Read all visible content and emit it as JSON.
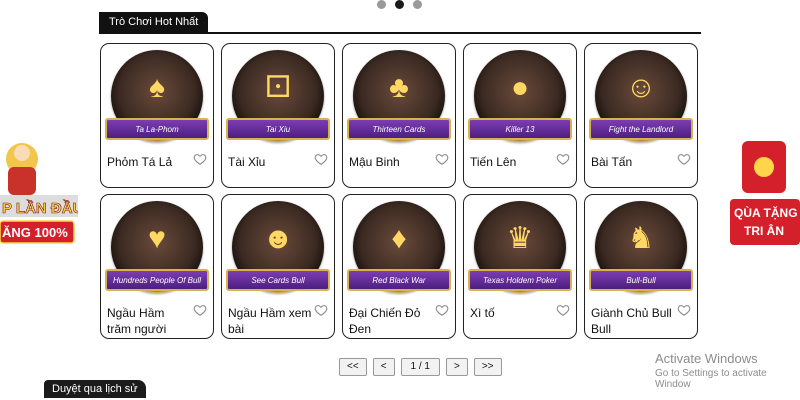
{
  "carousel": {
    "count": 3,
    "active": 2
  },
  "section": {
    "title": "Trò Chơi Hot Nhất"
  },
  "games": [
    {
      "name": "Phỏm Tá Lả",
      "ribbon": "Ta La-Phom",
      "icon": "phom-cards-icon",
      "glyph": "♠"
    },
    {
      "name": "Tài Xỉu",
      "ribbon": "Tai Xiu",
      "icon": "dice-cup-icon",
      "glyph": "⚀"
    },
    {
      "name": "Mậu Binh",
      "ribbon": "Thirteen Cards",
      "icon": "revolver-cards-icon",
      "glyph": "♣"
    },
    {
      "name": "Tiến Lên",
      "ribbon": "Killer 13",
      "icon": "bomb-cards-icon",
      "glyph": "●"
    },
    {
      "name": "Bài Tấn",
      "ribbon": "Fight the Landlord",
      "icon": "landlord-icon",
      "glyph": "☺"
    },
    {
      "name": "Ngầu Hầm trăm người",
      "ribbon": "Hundreds People Of Bull",
      "icon": "bull-cards-icon",
      "glyph": "♥"
    },
    {
      "name": "Ngầu Hầm xem bài",
      "ribbon": "See Cards Bull",
      "icon": "bull-mascot-icon",
      "glyph": "☻"
    },
    {
      "name": "Đại Chiến Đỏ Đen",
      "ribbon": "Red Black War",
      "icon": "red-black-vs-icon",
      "glyph": "♦"
    },
    {
      "name": "Xì tố",
      "ribbon": "Texas Holdem Poker",
      "icon": "crown-cards-icon",
      "glyph": "♛"
    },
    {
      "name": "Giành Chủ Bull Bull",
      "ribbon": "Bull-Bull",
      "icon": "bull-head-icon",
      "glyph": "♞"
    }
  ],
  "pagination": {
    "first": "<<",
    "prev": "<",
    "info": "1 / 1",
    "next": ">",
    "last": ">>"
  },
  "promo_left": {
    "lines": [
      "P LẦN ĐẦU",
      "ĂNG 100%"
    ]
  },
  "promo_right": {
    "lines": [
      "QÙA TẶNG",
      "TRI ÂN"
    ]
  },
  "watermark": {
    "title": "Activate Windows",
    "subtitle": "Go to Settings to activate Window"
  },
  "history_tab": {
    "label": "Duyệt qua lịch sử"
  },
  "colors": {
    "ribbon": "#5a2a8c",
    "gold": "#d8b24e",
    "promo_red": "#d3202b"
  }
}
